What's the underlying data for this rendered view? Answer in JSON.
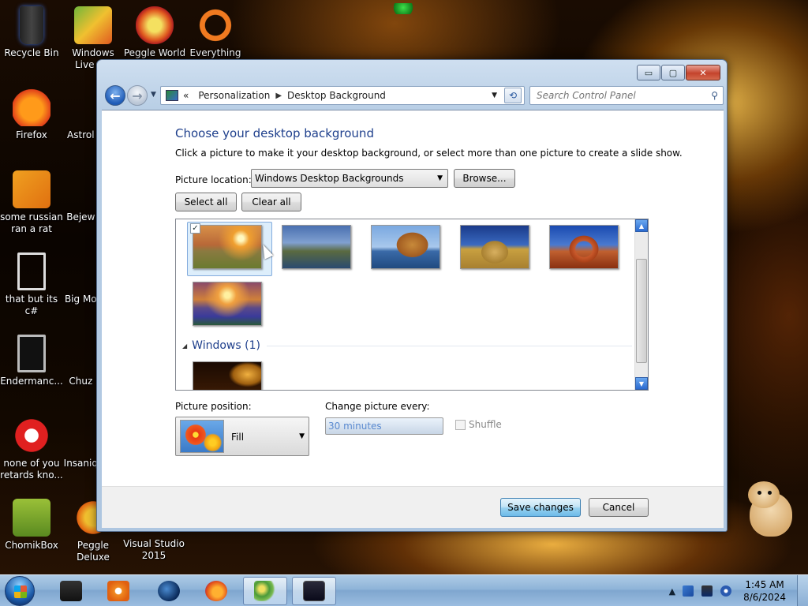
{
  "desktop": {
    "icons": [
      {
        "label": "Recycle Bin"
      },
      {
        "label": "Windows Live Ma"
      },
      {
        "label": "Peggle World"
      },
      {
        "label": "Everything"
      },
      {
        "label": "Firefox"
      },
      {
        "label": "Astrol Delu"
      },
      {
        "label": "some russian ran a rat"
      },
      {
        "label": "Bejew Delu"
      },
      {
        "label": "that but its c#"
      },
      {
        "label": "Big Mo Delu"
      },
      {
        "label": "Endermanc..."
      },
      {
        "label": "Chuz Delu"
      },
      {
        "label": "none of you retards kno..."
      },
      {
        "label": "Insaniq Delu"
      },
      {
        "label": "ChomikBox"
      },
      {
        "label": "Peggle Deluxe"
      },
      {
        "label": "Visual Studio 2015"
      }
    ]
  },
  "window": {
    "controls": {
      "minimize": "▭",
      "maximize": "▢",
      "close": "✕"
    },
    "breadcrumb": {
      "overflow": "«",
      "crumb1": "Personalization",
      "crumb2": "Desktop Background"
    },
    "search": {
      "placeholder": "Search Control Panel"
    }
  },
  "content": {
    "heading": "Choose your desktop background",
    "subtext": "Click a picture to make it your desktop background, or select more than one picture to create a slide show.",
    "picture_location": {
      "label": "Picture location:",
      "value": "Windows Desktop Backgrounds"
    },
    "browse_label": "Browse...",
    "select_all_label": "Select all",
    "clear_all_label": "Clear all",
    "thumbnails": [
      {
        "name": "sunset-field",
        "checked": true
      },
      {
        "name": "lighthouse"
      },
      {
        "name": "rock-lake"
      },
      {
        "name": "hay-bale"
      },
      {
        "name": "red-arch"
      },
      {
        "name": "flowers-lake"
      }
    ],
    "group": {
      "label": "Windows (1)"
    },
    "picture_position": {
      "label": "Picture position:",
      "value": "Fill"
    },
    "change_every": {
      "label": "Change picture every:",
      "value": "30 minutes"
    },
    "shuffle_label": "Shuffle"
  },
  "footer": {
    "save_label": "Save changes",
    "cancel_label": "Cancel"
  },
  "taskbar": {
    "clock_time": "1:45 AM",
    "clock_date": "8/6/2024",
    "tray_arrow": "▲"
  }
}
